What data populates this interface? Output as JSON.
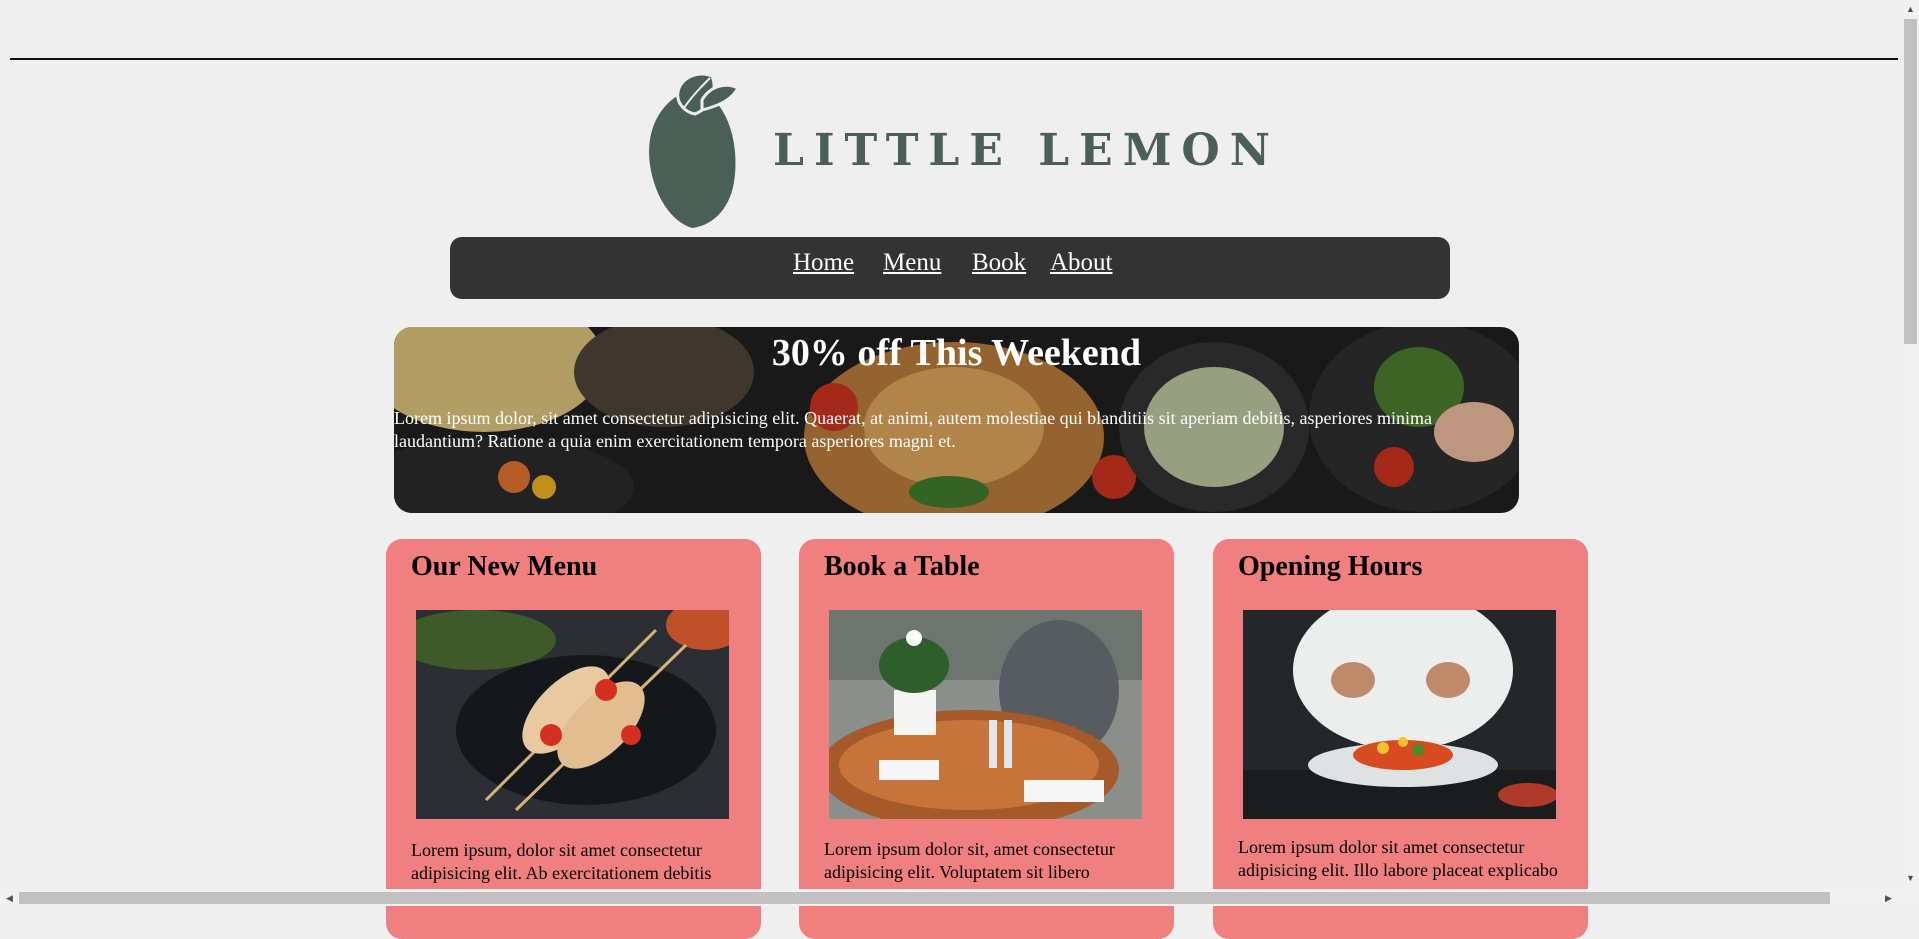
{
  "brand": {
    "name": "LITTLE LEMON"
  },
  "nav": {
    "items": [
      "Home",
      "Menu",
      "Book",
      "About"
    ]
  },
  "hero": {
    "title": "30% off This Weekend",
    "text": "Lorem ipsum dolor, sit amet consectetur adipisicing elit. Quaerat, at animi, autem molestiae qui blanditiis sit aperiam debitis, asperiores minima laudantium? Ratione a quia enim exercitationem tempora asperiores magni et."
  },
  "cards": [
    {
      "title": "Our New Menu",
      "text": "Lorem ipsum, dolor sit amet consectetur adipisicing elit. Ab exercitationem debitis"
    },
    {
      "title": "Book a Table",
      "text": "Lorem ipsum dolor sit, amet consectetur adipisicing elit. Voluptatem sit libero"
    },
    {
      "title": "Opening Hours",
      "text": "Lorem ipsum dolor sit amet consectetur adipisicing elit. Illo labore placeat explicabo"
    }
  ],
  "colors": {
    "nav_bg": "#333333",
    "card_bg": "#f08080",
    "brand_green": "#4a5f56",
    "page_bg": "#efefef"
  }
}
